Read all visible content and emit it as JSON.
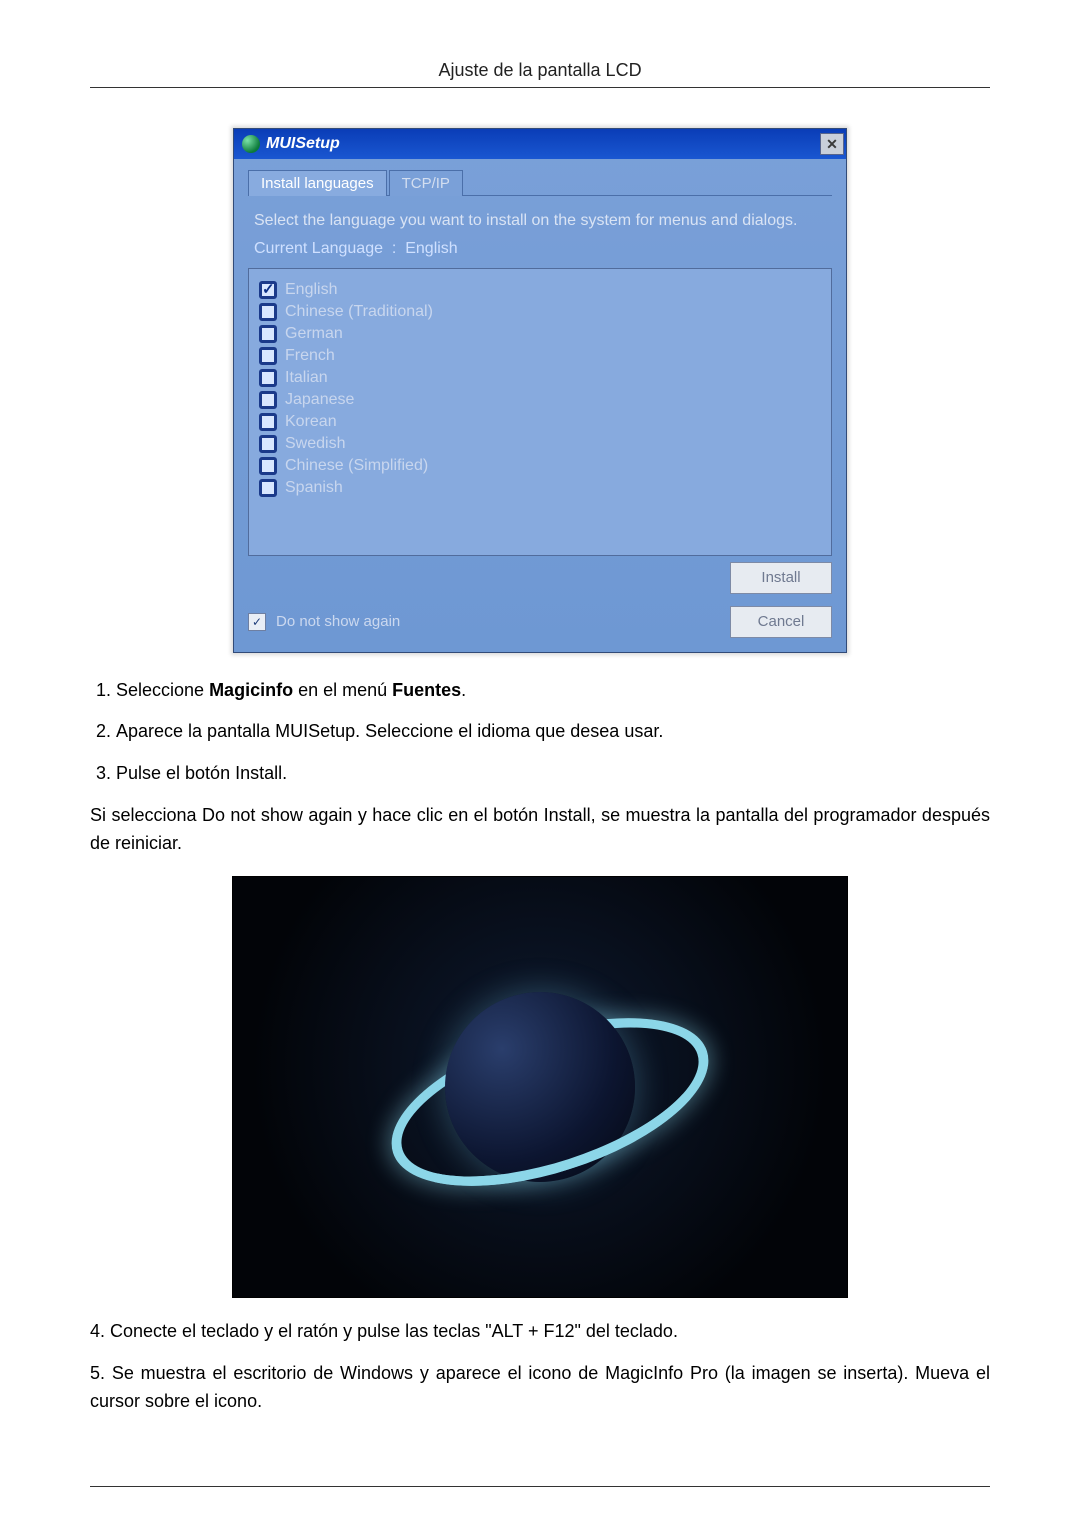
{
  "header": {
    "title": "Ajuste de la pantalla LCD"
  },
  "dialog": {
    "title": "MUISetup",
    "close_glyph": "✕",
    "tabs": {
      "install_languages": "Install languages",
      "tcpip": "TCP/IP"
    },
    "instructions": "Select the language you want to install on the system for menus and dialogs.",
    "current_language_label": "Current Language",
    "current_language_value": "English",
    "languages": [
      {
        "label": "English",
        "checked": true
      },
      {
        "label": "Chinese (Traditional)",
        "checked": false
      },
      {
        "label": "German",
        "checked": false
      },
      {
        "label": "French",
        "checked": false
      },
      {
        "label": "Italian",
        "checked": false
      },
      {
        "label": "Japanese",
        "checked": false
      },
      {
        "label": "Korean",
        "checked": false
      },
      {
        "label": "Swedish",
        "checked": false
      },
      {
        "label": "Chinese (Simplified)",
        "checked": false
      },
      {
        "label": "Spanish",
        "checked": false
      }
    ],
    "install_button": "Install",
    "dont_show_again": "Do not show again",
    "cancel_button": "Cancel"
  },
  "steps": {
    "s1_a": "Seleccione ",
    "s1_b": "Magicinfo",
    "s1_c": " en el menú ",
    "s1_d": "Fuentes",
    "s1_e": ".",
    "s2": "Aparece la pantalla MUISetup. Seleccione el idioma que desea usar.",
    "s3": "Pulse el botón Install.",
    "para": "Si selecciona Do not show again y hace clic en el botón Install, se muestra la pantalla del programador después de reiniciar.",
    "s4": "4. Conecte el teclado y el ratón y pulse las teclas \"ALT + F12\" del teclado.",
    "s5": "5. Se muestra el escritorio de Windows y aparece el icono de MagicInfo Pro (la imagen se inserta). Mueva el cursor sobre el icono."
  }
}
